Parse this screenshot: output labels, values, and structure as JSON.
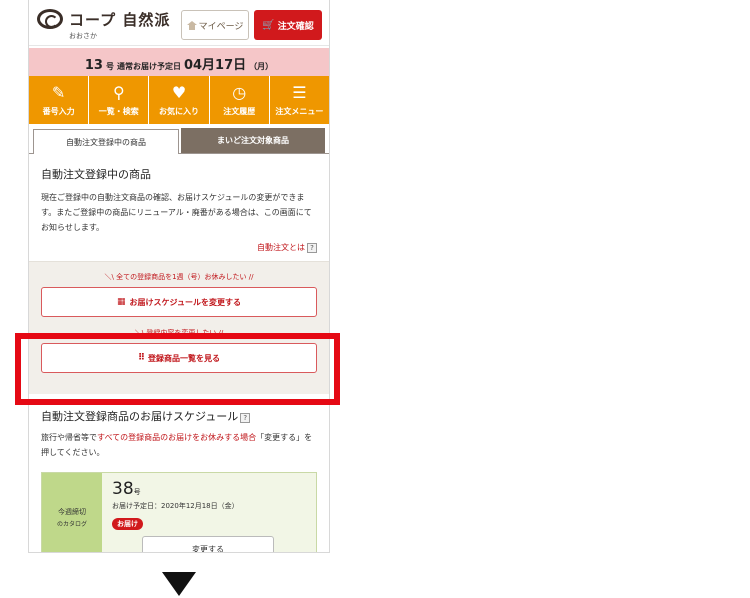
{
  "header": {
    "logo_text": "コープ 自然派",
    "logo_sub": "おおさか",
    "mypage_label": "マイページ",
    "cart_label": "注文確認"
  },
  "delivery": {
    "issue": "13",
    "issue_suffix": "号",
    "mid_text": "通常お届け予定日",
    "date": "04月17日",
    "weekday": "（月）"
  },
  "nav": [
    {
      "label": "番号入力",
      "icon": "pencil-icon"
    },
    {
      "label": "一覧・検索",
      "icon": "search-icon"
    },
    {
      "label": "お気に入り",
      "icon": "heart-icon"
    },
    {
      "label": "注文履歴",
      "icon": "clock-icon"
    },
    {
      "label": "注文メニュー",
      "icon": "menu-icon"
    }
  ],
  "tabs": [
    {
      "label": "自動注文登録中の商品",
      "active": true
    },
    {
      "label": "まいど注文対象商品",
      "active": false
    }
  ],
  "section1": {
    "title": "自動注文登録中の商品",
    "body": "現在ご登録中の自動注文商品の確認、お届けスケジュールの変更ができます。またご登録中の商品にリニューアル・廃番がある場合は、この画面にてお知らせします。",
    "help_link": "自動注文とは",
    "help_mark": "?"
  },
  "actions": {
    "caption1": "＼\\ 全ての登録商品を1週（号）お休みしたい //",
    "button1": "お届けスケジュールを変更する",
    "caption2": "＼\\ 登録内容を変更したい //",
    "button2": "登録商品一覧を見る"
  },
  "section2": {
    "title": "自動注文登録商品のお届けスケジュール",
    "help_mark": "?",
    "body_pre": "旅行や帰省等で",
    "body_emph": "すべての登録商品のお届けをお休みする場合",
    "body_post": "「変更する」を押してください。"
  },
  "schedule": {
    "left_title": "今週締切",
    "left_sub": "のカタログ",
    "issue": "38",
    "issue_suffix": "号",
    "date": "お届け予定日：2020年12月18日（金）",
    "badge": "お届け",
    "change_button": "変更する"
  },
  "colors": {
    "brand_red": "#d1191c",
    "nav_orange": "#ef9700",
    "delivery_pink": "#f5c6c8",
    "highlight_red": "#e50914"
  }
}
